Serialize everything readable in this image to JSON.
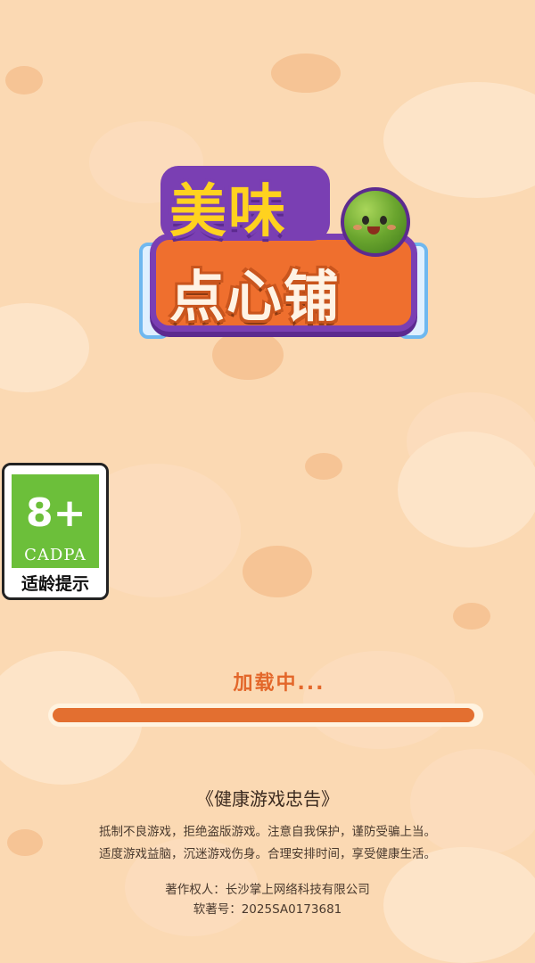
{
  "logo": {
    "line1": "美味",
    "line2": "点心铺"
  },
  "age_rating": {
    "number": "8+",
    "org": "CADPA",
    "label": "适龄提示"
  },
  "loading": {
    "text": "加载中...",
    "progress": 0.99
  },
  "health_advice": {
    "title": "《健康游戏忠告》",
    "lines": [
      "抵制不良游戏，拒绝盗版游戏。注意自我保护，谨防受骗上当。",
      "适度游戏益脑，沉迷游戏伤身。合理安排时间，享受健康生活。"
    ]
  },
  "copyright": {
    "owner": "著作权人：长沙掌上网络科技有限公司",
    "registration": "软著号：2025SA0173681"
  },
  "colors": {
    "background": "#fbd9b3",
    "accent": "#e36f30",
    "badge_green": "#6cbf3a"
  }
}
